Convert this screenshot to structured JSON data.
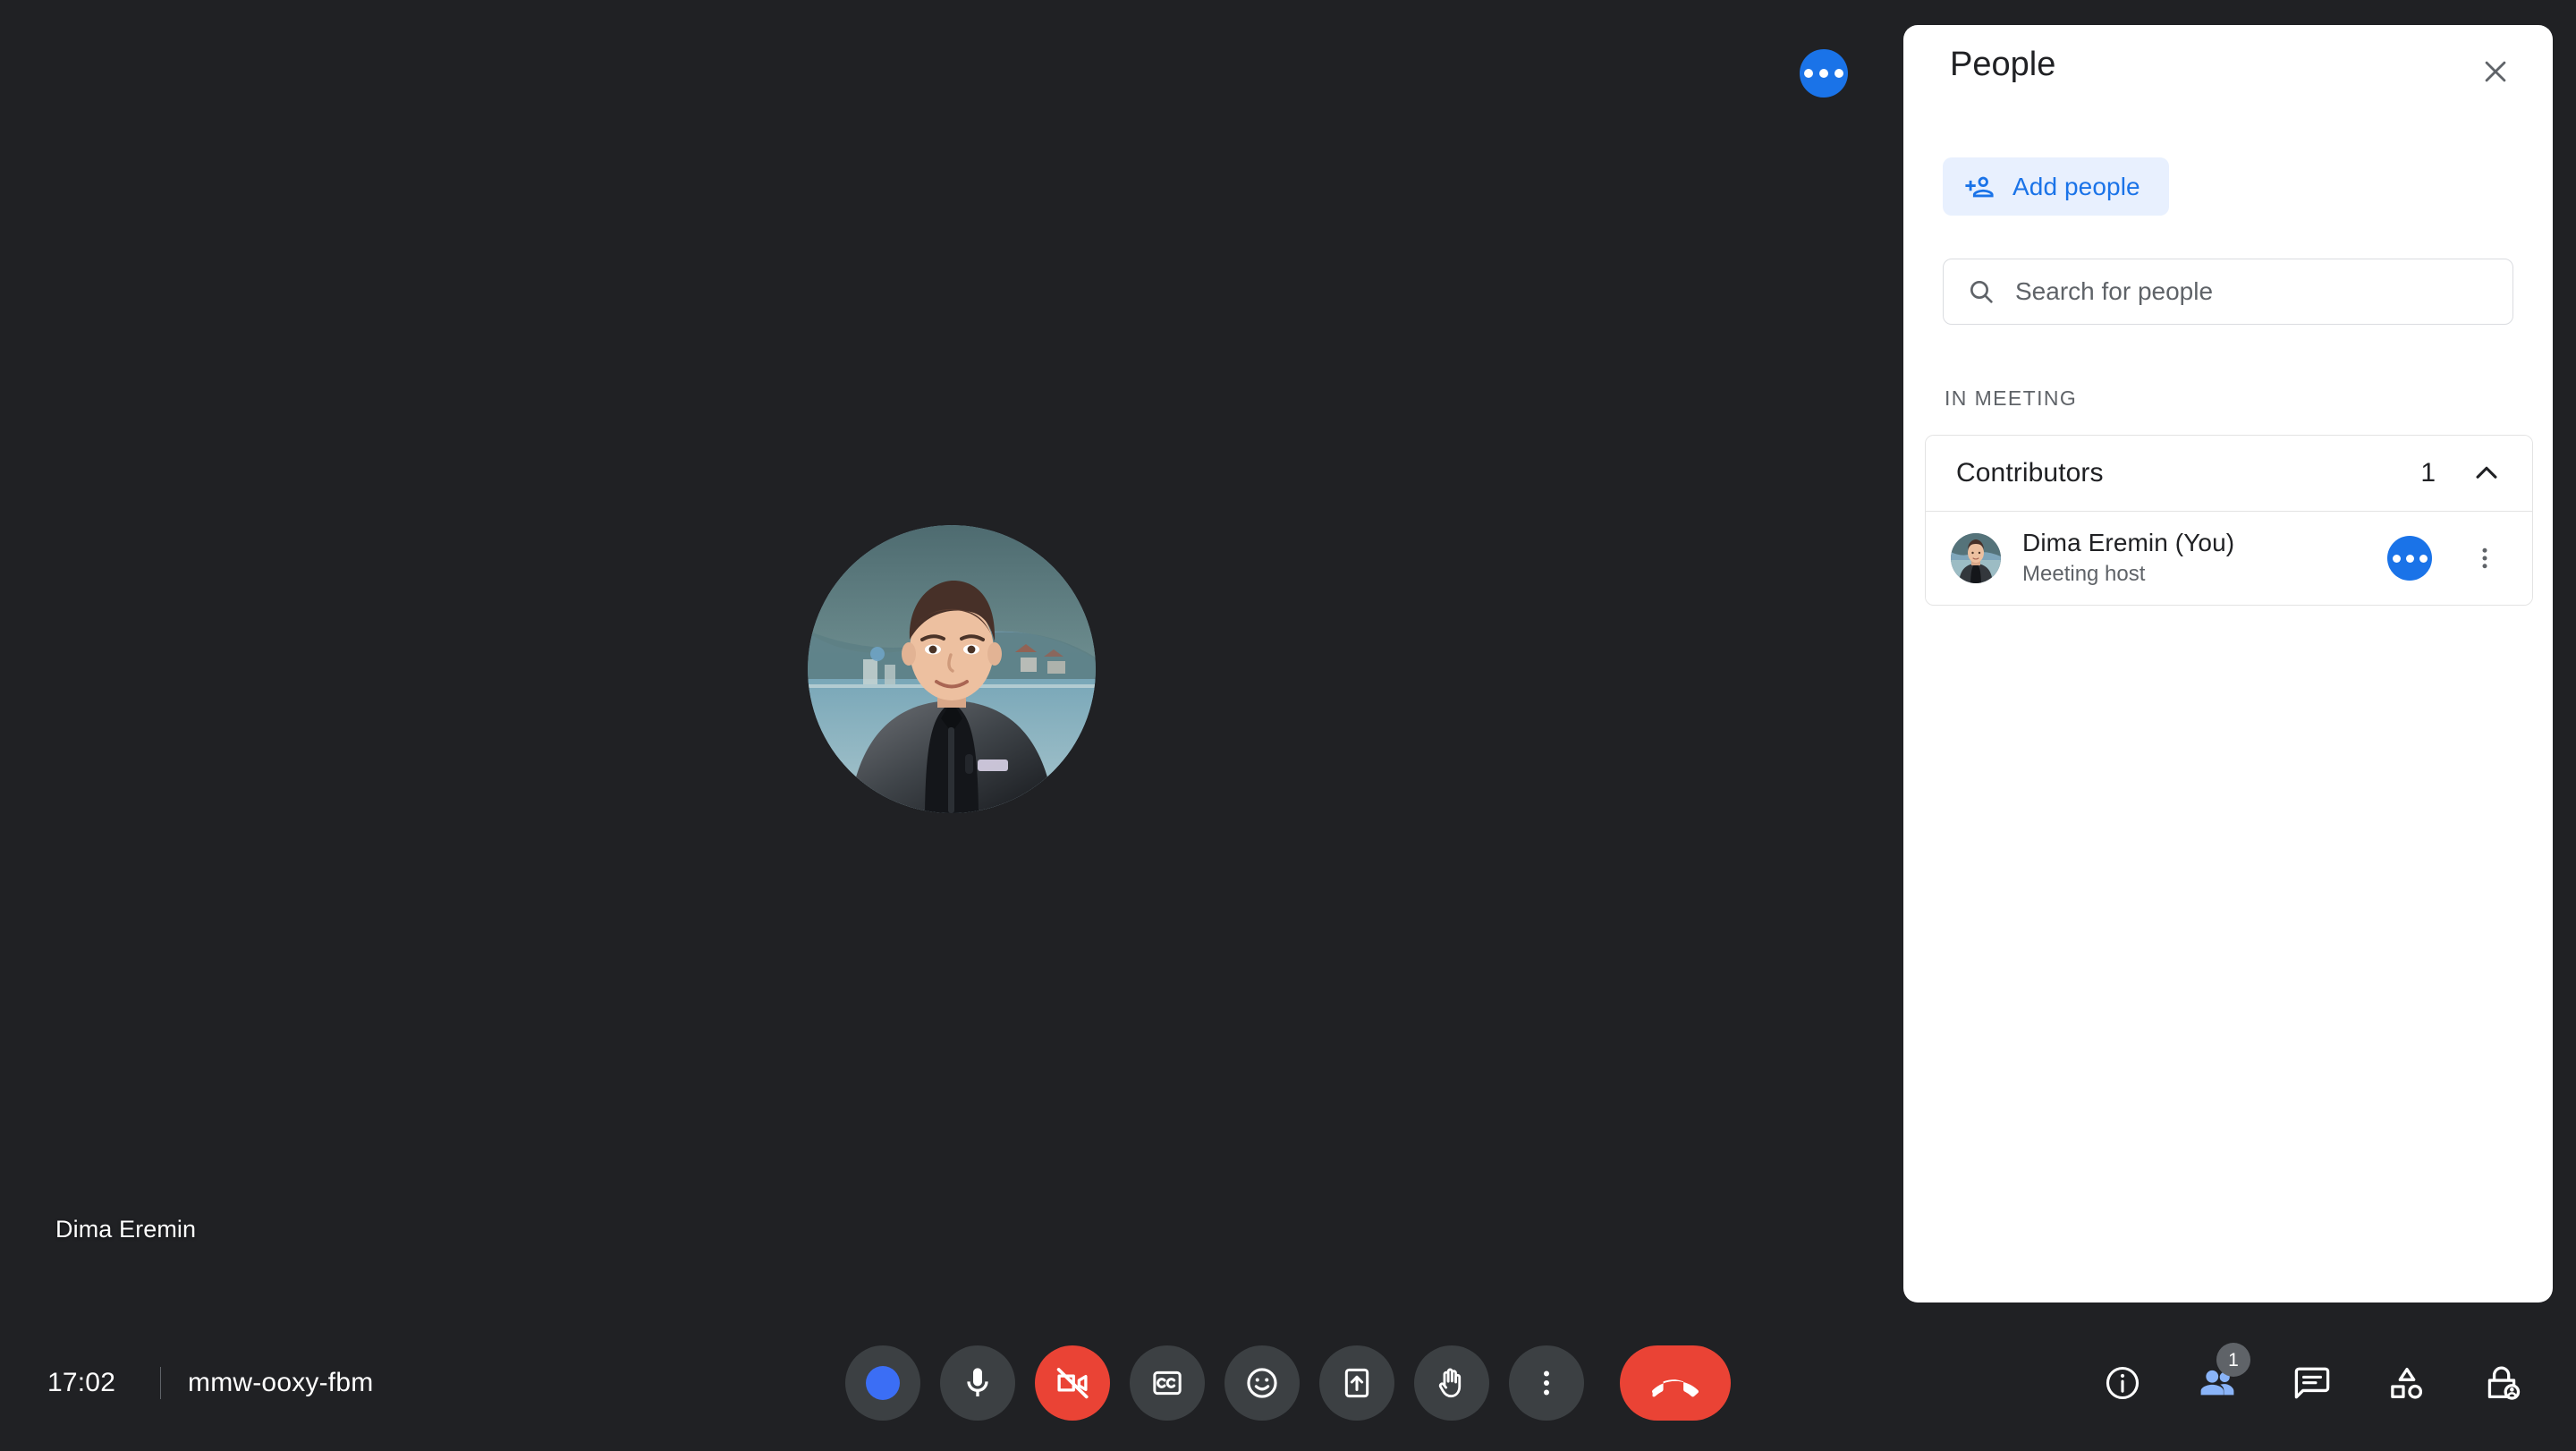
{
  "theme": {
    "background": "#202124",
    "panel_background": "#ffffff",
    "accent_blue": "#1a73e8",
    "danger_red": "#ea4335",
    "control_grey": "#3c4043",
    "muted_text": "#5f6368"
  },
  "stage": {
    "self_tile_name": "Dima Eremin",
    "more_options_icon": "more-horizontal-icon",
    "avatar_icon": "user-photo-avatar"
  },
  "bottom_bar": {
    "clock": "17:02",
    "meeting_code": "mmw-ooxy-fbm",
    "controls": [
      {
        "id": "effects",
        "name": "visual-effects-button",
        "icon": "blue-circle-icon",
        "style": "grey",
        "label": "Apply visual effects"
      },
      {
        "id": "mic",
        "name": "microphone-button",
        "icon": "microphone-icon",
        "style": "grey",
        "label": "Turn off microphone"
      },
      {
        "id": "camera",
        "name": "camera-button",
        "icon": "camera-off-icon",
        "style": "danger",
        "label": "Turn on camera"
      },
      {
        "id": "captions",
        "name": "captions-button",
        "icon": "closed-captions-icon",
        "style": "grey",
        "label": "Turn on captions"
      },
      {
        "id": "reactions",
        "name": "reactions-button",
        "icon": "emoji-smiley-icon",
        "style": "grey",
        "label": "Send a reaction"
      },
      {
        "id": "present",
        "name": "present-screen-button",
        "icon": "present-screen-icon",
        "style": "grey",
        "label": "Present now"
      },
      {
        "id": "raisehand",
        "name": "raise-hand-button",
        "icon": "raised-hand-icon",
        "style": "grey",
        "label": "Raise hand"
      },
      {
        "id": "more",
        "name": "more-options-button",
        "icon": "more-vertical-icon",
        "style": "grey",
        "label": "More options"
      },
      {
        "id": "leave",
        "name": "leave-call-button",
        "icon": "end-call-icon",
        "style": "end",
        "label": "Leave call"
      }
    ],
    "right_icons": [
      {
        "id": "info",
        "name": "meeting-details-button",
        "icon": "info-circle-icon",
        "badge": "",
        "active": false,
        "label": "Meeting details"
      },
      {
        "id": "people",
        "name": "people-button",
        "icon": "people-icon",
        "badge": "1",
        "active": true,
        "label": "People"
      },
      {
        "id": "chat",
        "name": "chat-button",
        "icon": "chat-bubble-icon",
        "badge": "",
        "active": false,
        "label": "Chat with everyone"
      },
      {
        "id": "activities",
        "name": "activities-button",
        "icon": "shapes-icon",
        "badge": "",
        "active": false,
        "label": "Activities"
      },
      {
        "id": "hostctrl",
        "name": "host-controls-button",
        "icon": "lock-person-icon",
        "badge": "",
        "active": false,
        "label": "Host controls"
      }
    ]
  },
  "people_panel": {
    "title": "People",
    "close_icon": "close-icon",
    "add_people_label": "Add people",
    "add_people_icon": "person-add-icon",
    "search": {
      "placeholder": "Search for people",
      "value": "",
      "icon": "search-icon"
    },
    "section_label": "In meeting",
    "group": {
      "name": "Contributors",
      "count": "1",
      "chevron_icon": "chevron-up-icon",
      "expanded": true
    },
    "participants": [
      {
        "name": "Dima Eremin (You)",
        "role": "Meeting host",
        "avatar_icon": "user-photo-avatar",
        "status_icon": "more-horizontal-icon",
        "menu_icon": "more-vertical-icon"
      }
    ]
  }
}
